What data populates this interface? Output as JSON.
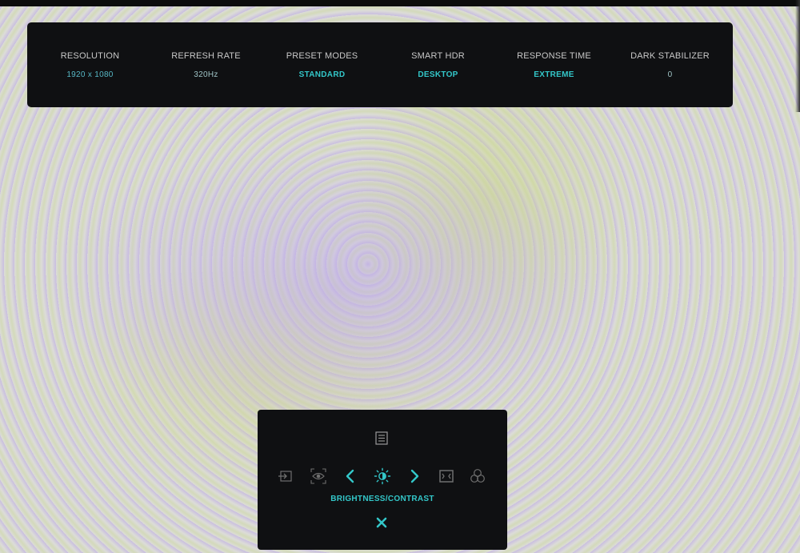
{
  "info_bar": {
    "items": [
      {
        "label": "RESOLUTION",
        "value": "1920 x 1080"
      },
      {
        "label": "REFRESH RATE",
        "value": "320Hz"
      },
      {
        "label": "PRESET MODES",
        "value": "STANDARD"
      },
      {
        "label": "SMART HDR",
        "value": "DESKTOP"
      },
      {
        "label": "RESPONSE TIME",
        "value": "EXTREME"
      },
      {
        "label": "DARK STABILIZER",
        "value": "0"
      }
    ]
  },
  "osd": {
    "top_icon": "menu-list-icon",
    "icons": [
      "input-source-icon",
      "eye-icon",
      "chevron-left-icon",
      "brightness-icon",
      "chevron-right-icon",
      "aspect-ratio-icon",
      "color-circles-icon"
    ],
    "selected_label": "BRIGHTNESS/CONTRAST",
    "close_icon": "close-icon"
  },
  "colors": {
    "accent": "#33c7c9",
    "panel": "#0f1012",
    "label": "#c8c8c8",
    "dim_icon": "#6f6f6f"
  }
}
